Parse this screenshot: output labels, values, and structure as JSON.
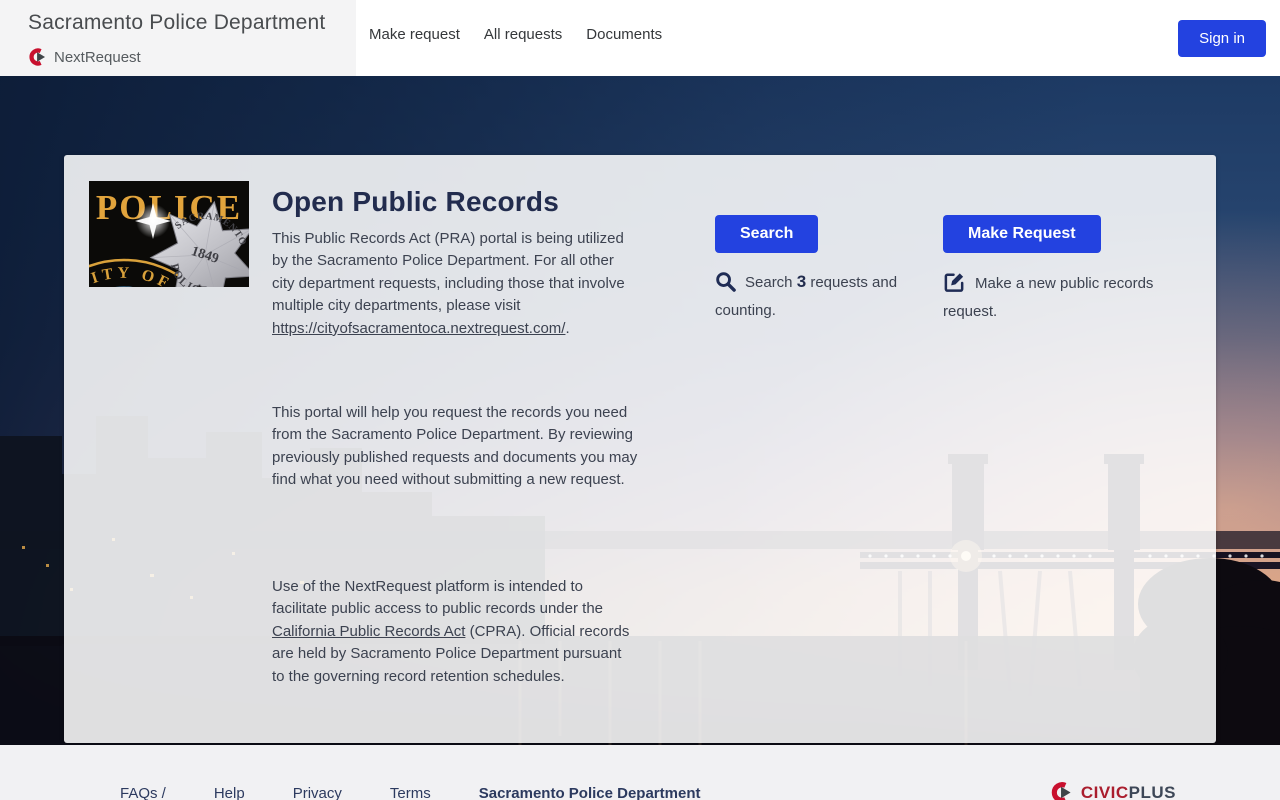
{
  "header": {
    "agency_title": "Sacramento Police Department",
    "platform_name": "NextRequest",
    "nav": [
      {
        "label": "Make request"
      },
      {
        "label": "All requests"
      },
      {
        "label": "Documents"
      }
    ],
    "sign_in_label": "Sign in"
  },
  "hero": {
    "title": "Open Public Records",
    "intro_before_link": "This Public Records Act (PRA) portal is being utilized by the Sacramento Police Department. For all other city department requests, including those that involve multiple city departments, please visit ",
    "intro_link_text": "https://cityofsacramentoca.nextrequest.com/",
    "intro_after_link": ".",
    "paragraph2": "This portal will help you request the records you need from the Sacramento Police Department. By reviewing previously published requests and documents you may find what you need without submitting a new request.",
    "paragraph3_before_link": "Use of the NextRequest platform is intended to facilitate public access to public records under the ",
    "paragraph3_link_text": "California Public Records Act",
    "paragraph3_after_link": " (CPRA). Official records are held by Sacramento Police Department pursuant to the governing record retention schedules.",
    "search_button": "Search",
    "make_request_button": "Make Request",
    "search_caption_before": "Search ",
    "search_count": "3",
    "search_caption_after": " requests and counting.",
    "request_caption": "Make a new public records request."
  },
  "police_badge": {
    "police_text": "POLICE",
    "city_of_text": "CITY OF",
    "star_top": "SACRAMENTO",
    "star_year": "1849",
    "star_bottom": "POLICE"
  },
  "footer": {
    "links": [
      "FAQs /",
      "Help",
      "Privacy",
      "Terms"
    ],
    "agency_link": "Sacramento Police Department",
    "civicplus_civic": "CIVIC",
    "civicplus_plus": "PLUS"
  },
  "colors": {
    "primary_blue": "#2342e0",
    "heading_navy": "#222c4e",
    "brand_red": "#c8102e",
    "footer_bg": "#f1f1f3"
  }
}
